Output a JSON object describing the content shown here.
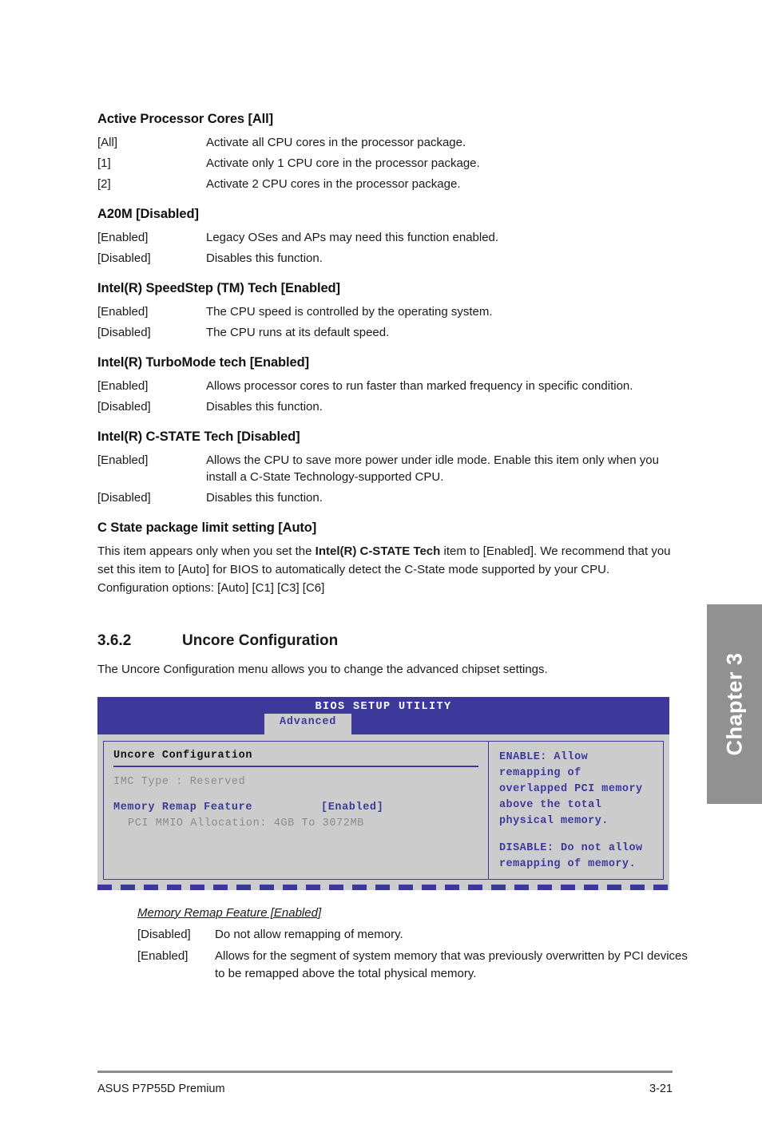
{
  "chapter_tab": {
    "label": "Chapter 3"
  },
  "sections": [
    {
      "title": "Active Processor Cores [All]",
      "options": [
        {
          "key": "[All]",
          "desc": "Activate all CPU cores in the processor package."
        },
        {
          "key": "[1]",
          "desc": "Activate only 1 CPU core in the processor package."
        },
        {
          "key": "[2]",
          "desc": "Activate 2 CPU cores in the processor package."
        }
      ]
    },
    {
      "title": "A20M [Disabled]",
      "options": [
        {
          "key": "[Enabled]",
          "desc": "Legacy OSes and APs may need this function enabled."
        },
        {
          "key": "[Disabled]",
          "desc": "Disables this function."
        }
      ]
    },
    {
      "title": "Intel(R) SpeedStep (TM) Tech [Enabled]",
      "options": [
        {
          "key": "[Enabled]",
          "desc": "The CPU speed is controlled by the operating system."
        },
        {
          "key": "[Disabled]",
          "desc": "The CPU runs at its default speed."
        }
      ]
    },
    {
      "title": "Intel(R) TurboMode tech [Enabled]",
      "options": [
        {
          "key": "[Enabled]",
          "desc": "Allows processor cores to run faster than marked frequency in specific condition."
        },
        {
          "key": "[Disabled]",
          "desc": "Disables this function."
        }
      ]
    },
    {
      "title": "Intel(R) C-STATE Tech [Disabled]",
      "options": [
        {
          "key": "[Enabled]",
          "desc": "Allows the CPU to save more power under idle mode. Enable this item only when you install a C-State Technology-supported CPU."
        },
        {
          "key": "[Disabled]",
          "desc": "Disables this function."
        }
      ]
    }
  ],
  "c_state_package": {
    "title": "C State package limit setting [Auto]",
    "paragraph_part1": "This item appears only when you set the ",
    "paragraph_bold": "Intel(R) C-STATE Tech",
    "paragraph_part2": " item to [Enabled]. We recommend that you set this item to [Auto] for BIOS to automatically detect the C-State mode supported by your CPU. Configuration options: [Auto] [C1] [C3] [C6]"
  },
  "uncore_section": {
    "number": "3.6.2",
    "title": "Uncore Configuration",
    "intro": "The Uncore Configuration menu allows you to change the advanced chipset settings."
  },
  "bios": {
    "title": "BIOS SETUP UTILITY",
    "active_tab": "Advanced",
    "panel_heading": "Uncore Configuration",
    "imc_line": "IMC Type : Reserved",
    "remap_label": "Memory Remap Feature",
    "remap_value": "[Enabled]",
    "mmio_line": "PCI MMIO Allocation: 4GB To 3072MB",
    "help_enable": "ENABLE: Allow\nremapping of\noverlapped PCI memory\nabove the total\nphysical memory.",
    "help_disable": "DISABLE: Do not allow\nremapping of memory.",
    "colors": {
      "header_blue": "#3d399b",
      "panel_gray": "#cccccc",
      "dim_text": "#8a8a8a"
    }
  },
  "memory_remap": {
    "title": "Memory Remap Feature [Enabled]",
    "options": [
      {
        "key": "[Disabled]",
        "desc": "Do not allow remapping of memory."
      },
      {
        "key": "[Enabled]",
        "desc": "Allows for the segment of system memory that was previously overwritten by PCI devices to be remapped above the total physical memory."
      }
    ]
  },
  "footer": {
    "product": "ASUS P7P55D Premium",
    "page_number": "3-21"
  }
}
